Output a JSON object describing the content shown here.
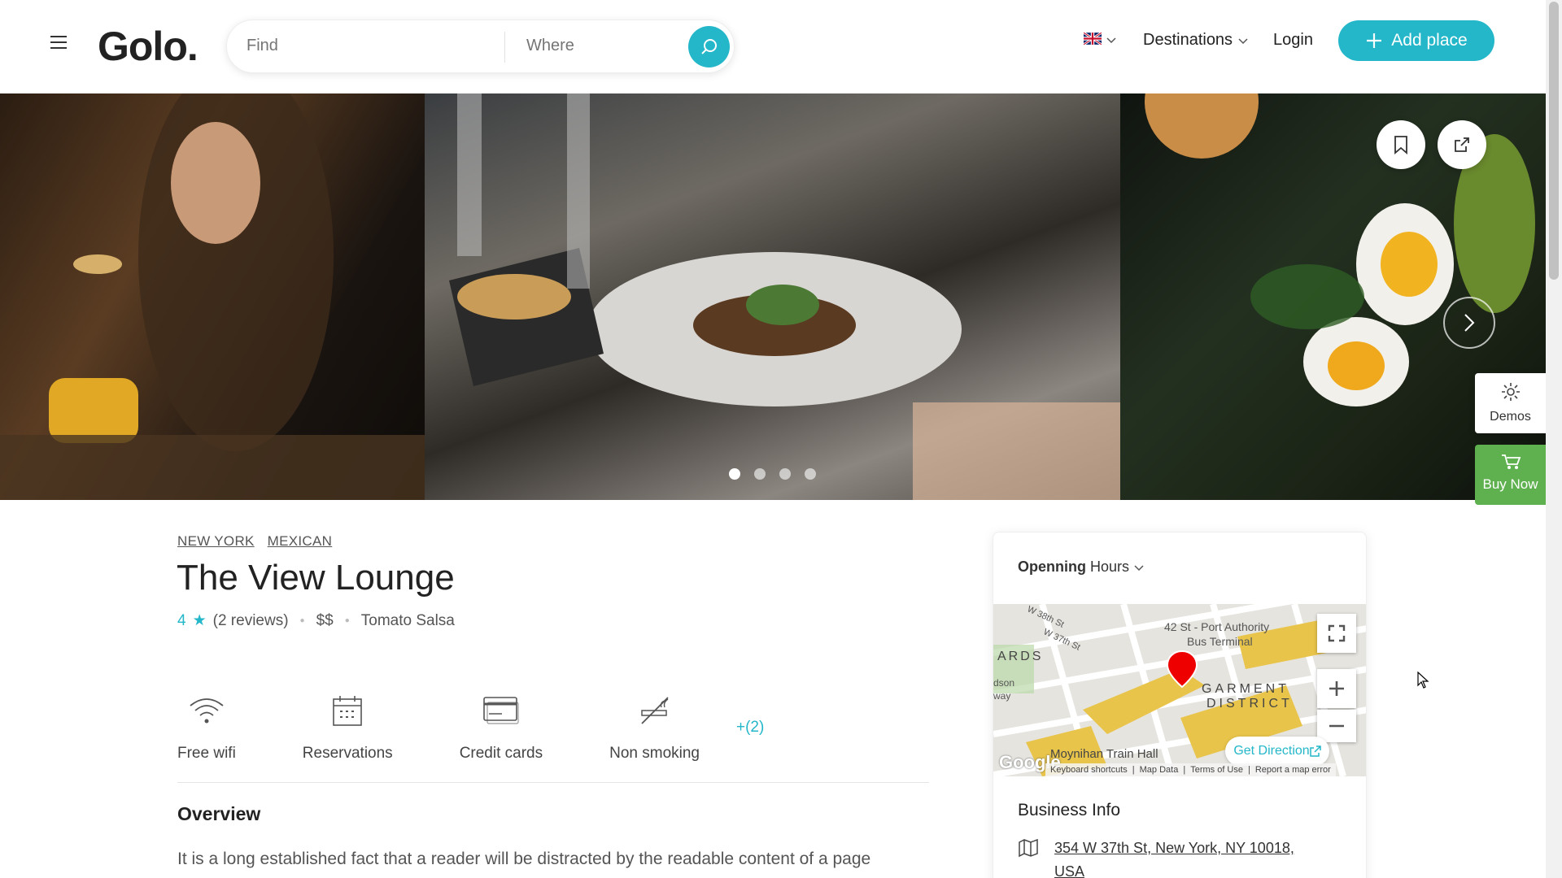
{
  "header": {
    "logo": "Golo.",
    "search": {
      "find_placeholder": "Find",
      "where_placeholder": "Where"
    },
    "language_flag": "uk-flag-icon",
    "nav": {
      "destinations": "Destinations",
      "login": "Login"
    },
    "add_place": "Add place"
  },
  "gallery": {
    "dots_total": 4,
    "active_dot": 1
  },
  "side": {
    "demos": "Demos",
    "buy_now": "Buy Now"
  },
  "listing": {
    "tags": [
      "NEW YORK",
      "MEXICAN"
    ],
    "title": "The View Lounge",
    "rating": "4",
    "reviews": "(2 reviews)",
    "price": "$$",
    "specialty": "Tomato Salsa",
    "amenities": [
      {
        "label": "Free wifi",
        "icon": "wifi-icon"
      },
      {
        "label": "Reservations",
        "icon": "calendar-icon"
      },
      {
        "label": "Credit cards",
        "icon": "credit-card-icon"
      },
      {
        "label": "Non smoking",
        "icon": "no-smoking-icon"
      }
    ],
    "more_amenities": "+(2)",
    "overview_heading": "Overview",
    "overview_text": "It is a long established fact that a reader will be distracted by the readable content of a page"
  },
  "card": {
    "hours_bold": "Openning",
    "hours_rest": "Hours",
    "map": {
      "labels": [
        "W 38th St",
        "W 37th St",
        "42 St - Port Authority",
        "Bus Terminal",
        "ARDS",
        "dson",
        "way",
        "GARMENT",
        "DISTRICT",
        "Moynihan Train Hall"
      ],
      "get_direction": "Get Direction",
      "google": "Google",
      "footer": [
        "Keyboard shortcuts",
        "Map Data",
        "Terms of Use",
        "Report a map error"
      ]
    },
    "business_info": "Business Info",
    "address_line1": "354 W 37th St, New York, NY 10018,",
    "address_line2": "USA"
  },
  "colors": {
    "accent": "#23b7c9",
    "buy_now": "#5fb14f"
  }
}
